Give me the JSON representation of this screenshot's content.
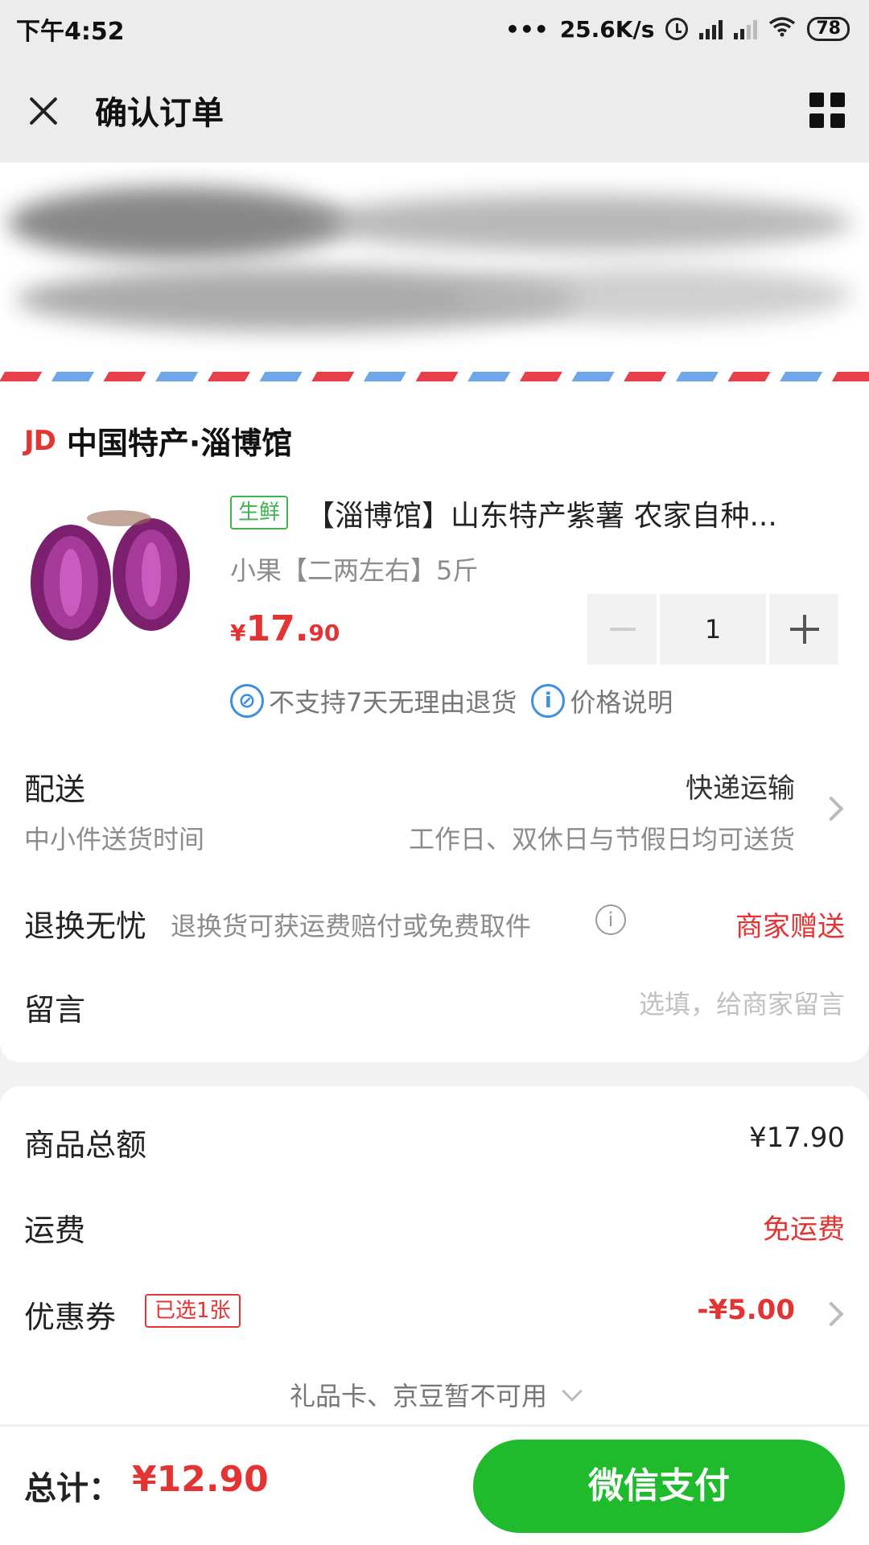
{
  "status_bar": {
    "time": "下午4:52",
    "network_speed": "25.6K/s",
    "battery": "78"
  },
  "header": {
    "title": "确认订单",
    "close_icon": "close-icon",
    "menu_icon": "grid-icon"
  },
  "shop": {
    "logo": "JD",
    "name": "中国特产·淄博馆"
  },
  "product": {
    "tag": "生鲜",
    "title": "【淄博馆】山东特产紫薯 农家自种...",
    "spec": "小果【二两左右】5斤",
    "price_symbol": "¥",
    "price_int": "17.",
    "price_dec": "90",
    "quantity": "1",
    "no_return_text": "不支持7天无理由退货",
    "price_info_text": "价格说明"
  },
  "delivery": {
    "label": "配送",
    "value": "快递运输",
    "sub_label": "中小件送货时间",
    "sub_value": "工作日、双休日与节假日均可送货"
  },
  "return_service": {
    "label": "退换无忧",
    "desc": "退换货可获运费赔付或免费取件",
    "value": "商家赠送"
  },
  "message": {
    "label": "留言",
    "placeholder": "选填，给商家留言"
  },
  "summary": {
    "goods_total_label": "商品总额",
    "goods_total_value": "¥17.90",
    "shipping_label": "运费",
    "shipping_value": "免运费",
    "coupon_label": "优惠券",
    "coupon_tag": "已选1张",
    "coupon_value": "-¥5.00",
    "gift_card_text": "礼品卡、京豆暂不可用"
  },
  "footer": {
    "total_label": "总计：",
    "total_value": "¥12.90",
    "pay_button": "微信支付"
  },
  "colors": {
    "accent_red": "#e33333",
    "pay_green": "#1fbb2c",
    "fresh_green": "#3fb34f",
    "info_blue": "#3d8fe0"
  }
}
